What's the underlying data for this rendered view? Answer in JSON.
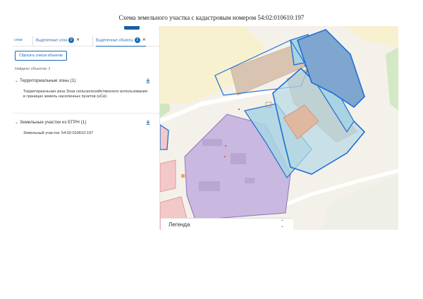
{
  "document": {
    "title": "Схема земельного участка с кадастровым номером 54:02:010610:197"
  },
  "panel": {
    "tabs": [
      {
        "label": "слои",
        "badge": "",
        "closable": false,
        "active": false
      },
      {
        "label": "Выделенные слои",
        "badge": "0",
        "closable": true,
        "active": false
      },
      {
        "label": "Выделенные объекты",
        "badge": "2",
        "closable": true,
        "active": true
      }
    ],
    "reset_button": "Сбросить список объектов",
    "found_count": "Найдено объектов: 2",
    "sections": [
      {
        "title": "Территориальные зоны (1)",
        "item": "Территориальная зона Зона сельскохозяйственного использования в границах земель населенных пунктов (нСи)"
      },
      {
        "title": "Земельные участки из ЕГРН (1)",
        "item": "Земельный участок: 54:02:010610:197"
      }
    ]
  },
  "legend": {
    "label": "Легенда"
  },
  "colors": {
    "accent": "#1a67b5",
    "parcel_outline": "#1f6fd1",
    "zone_fill": "#c9b8e0"
  }
}
